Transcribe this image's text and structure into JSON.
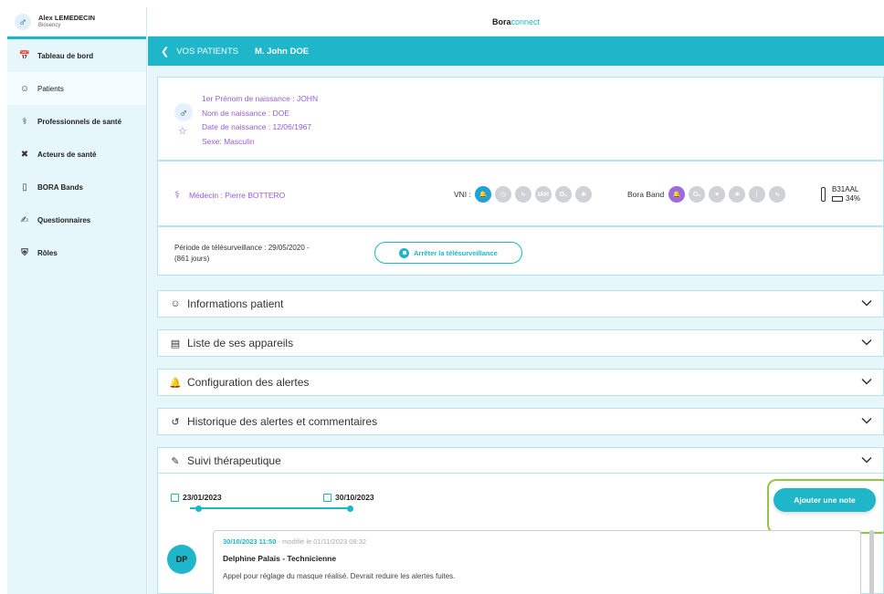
{
  "user": {
    "avatar_symbol": "♂",
    "name": "Alex LEMEDECIN",
    "org": "Biosency"
  },
  "sidebar": {
    "items": [
      {
        "label": "Tableau de bord",
        "icon": "calendar-icon"
      },
      {
        "label": "Patients",
        "icon": "user-icon"
      },
      {
        "label": "Professionnels de santé",
        "icon": "stethoscope-icon"
      },
      {
        "label": "Acteurs de santé",
        "icon": "tools-icon"
      },
      {
        "label": "BORA Bands",
        "icon": "band-icon"
      },
      {
        "label": "Questionnaires",
        "icon": "form-icon"
      },
      {
        "label": "Rôles",
        "icon": "shield-icon"
      }
    ]
  },
  "topbar": {
    "brand_bold": "Bora",
    "brand_light": "connect"
  },
  "breadcrumb": {
    "back": "VOS PATIENTS",
    "patient": "M. John DOE"
  },
  "patient": {
    "sex_symbol": "♂",
    "lines": [
      "1er Prénom de naissance : JOHN",
      "Nom de naissance : DOE",
      "Date de naissance : 12/06/1967",
      "Sexe: Masculin"
    ]
  },
  "devices": {
    "doctor": "Médecin : Pierre BOTTERO",
    "vni_label": "VNI :",
    "vni_icons": [
      "alarm-icon",
      "clock-icon",
      "leak-icon",
      "IAH",
      "O₂",
      "lungs-icon"
    ],
    "vni_icon_text": [
      "",
      "",
      "",
      "IAH",
      "O₂",
      ""
    ],
    "bb_label": "Bora Band",
    "bb_icons": [
      "alarm-icon",
      "o2-icon",
      "heart-icon",
      "lungs-icon",
      "thermo-icon",
      "pulse-icon"
    ],
    "bb_icon_text": [
      "",
      "O₂",
      "",
      "",
      "",
      ""
    ],
    "band_id": "B31AAL",
    "battery": "34%"
  },
  "telesurveillance": {
    "line1": "Période de télésurveillance : 29/05/2020 -",
    "line2": "(861 jours)",
    "stop_label": "Arrêter la télésurveillance"
  },
  "sections": [
    {
      "label": "Informations patient",
      "icon": "user-icon",
      "symbol": "👤"
    },
    {
      "label": "Liste de ses appareils",
      "icon": "devices-icon",
      "symbol": "🗄"
    },
    {
      "label": "Configuration des alertes",
      "icon": "bell-icon",
      "symbol": "🔔"
    },
    {
      "label": "Historique des alertes et commentaires",
      "icon": "history-icon",
      "symbol": "↺"
    },
    {
      "label": "Suivi thérapeutique",
      "icon": "notes-icon",
      "symbol": "✎"
    }
  ],
  "suivi": {
    "date_start": "23/01/2023",
    "date_end": "30/10/2023",
    "add_note_label": "Ajouter une note",
    "note": {
      "initials": "DP",
      "timestamp": "30/10/2023 11:50",
      "modified": " - modifié le 01/11/2023 08:32",
      "author": "Delphine Palais - Technicienne",
      "text": "Appel pour réglage du masque réalisé. Devrait reduire les alertes fuites."
    }
  }
}
